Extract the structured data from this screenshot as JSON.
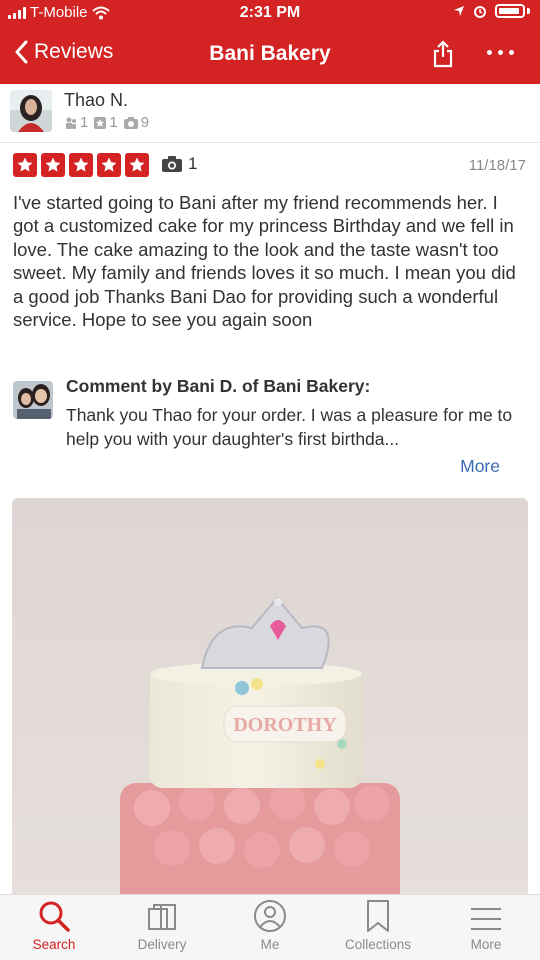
{
  "status_bar": {
    "carrier": "T-Mobile",
    "time": "2:31 PM"
  },
  "nav": {
    "back_label": "Reviews",
    "title": "Bani Bakery"
  },
  "reviewer": {
    "name": "Thao N.",
    "friends": "1",
    "reviews": "1",
    "photos": "9"
  },
  "review": {
    "stars": 5,
    "photo_count": "1",
    "date": "11/18/17",
    "text": "I've started going to Bani after my friend recommends her. I got a customized cake for my princess  Birthday and we fell in love.  The cake amazing to the look and the taste wasn't too sweet. My family and friends loves it so much. I mean you did a good job  Thanks Bani Dao for providing such a wonderful service. Hope to see you again soon"
  },
  "owner_comment": {
    "title": "Comment by Bani D. of Bani Bakery:",
    "text": "Thank you Thao for your order. I was a pleasure for me to help you with your daughter's first birthda...",
    "more_label": "More"
  },
  "photo": {
    "cake_text": "DOROTHY"
  },
  "tabs": [
    {
      "label": "Search",
      "icon": "search-icon",
      "active": true
    },
    {
      "label": "Delivery",
      "icon": "delivery-bag-icon",
      "active": false
    },
    {
      "label": "Me",
      "icon": "profile-icon",
      "active": false
    },
    {
      "label": "Collections",
      "icon": "bookmark-icon",
      "active": false
    },
    {
      "label": "More",
      "icon": "menu-icon",
      "active": false
    }
  ],
  "colors": {
    "brand": "#d32323",
    "link": "#3b6db5",
    "muted": "#8a8a8a"
  }
}
